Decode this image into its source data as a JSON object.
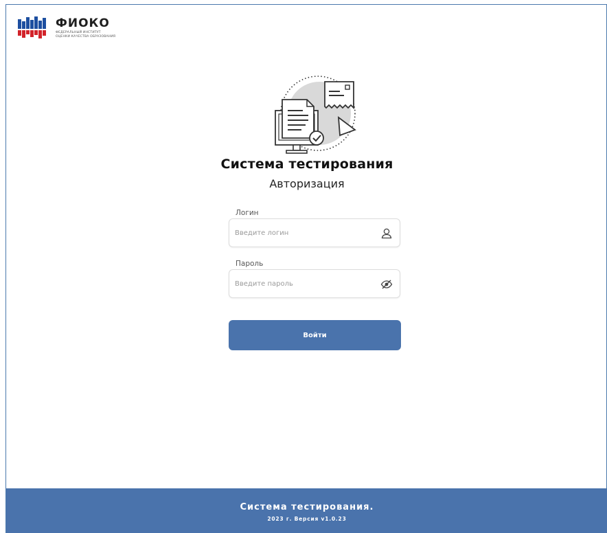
{
  "logo": {
    "name": "ФИОКО",
    "subtitle_line1": "Федеральный институт",
    "subtitle_line2": "оценки качества образования"
  },
  "header": {
    "title": "Система тестирования",
    "subtitle": "Авторизация"
  },
  "form": {
    "login_label": "Логин",
    "login_placeholder": "Введите логин",
    "login_value": "",
    "password_label": "Пароль",
    "password_placeholder": "Введите пароль",
    "password_value": "",
    "submit_label": "Войти"
  },
  "footer": {
    "title": "Система тестирования.",
    "version": "2023 г. Версия v1.0.23"
  },
  "icons": {
    "login_field": "user-icon",
    "password_field": "eye-slash-icon"
  },
  "colors": {
    "accent": "#4a73ac",
    "frame_border": "#4a78ad",
    "logo_blue": "#1d4fa0",
    "logo_red": "#d2232a"
  }
}
